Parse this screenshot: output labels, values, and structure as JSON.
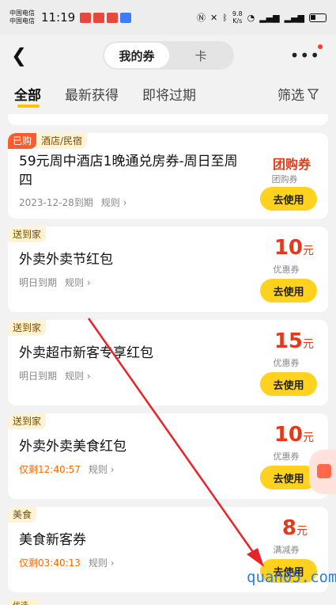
{
  "status_bar": {
    "carrier_1": "中国电信",
    "carrier_2": "中国电信",
    "time": "11:19",
    "net_speed_value": "9.8",
    "net_speed_unit": "K/s"
  },
  "nav": {
    "segment_active": "我的券",
    "segment_inactive": "卡"
  },
  "tabs": [
    {
      "label": "全部"
    },
    {
      "label": "最新获得"
    },
    {
      "label": "即将过期"
    }
  ],
  "filter_label": "筛选",
  "coupons": [
    {
      "bought_tag": "已购",
      "category": "酒店/民宿",
      "title_line1": "59元周中酒店1晚通兑房券-周日至周",
      "title_line2": "四",
      "expiry": "2023-12-28到期",
      "rule": "规则",
      "value_text": "团购券",
      "kind": "团购券",
      "button": "去使用"
    },
    {
      "category": "送到家",
      "title": "外卖外卖节红包",
      "expiry": "明日到期",
      "rule": "规则",
      "amount": "10",
      "unit": "元",
      "kind": "优惠券",
      "button": "去使用"
    },
    {
      "category": "送到家",
      "title": "外卖超市新客专享红包",
      "expiry": "明日到期",
      "rule": "规则",
      "amount": "15",
      "unit": "元",
      "kind": "优惠券",
      "button": "去使用"
    },
    {
      "category": "送到家",
      "title": "外卖外卖美食红包",
      "expiry": "仅剩12:40:57",
      "rule": "规则",
      "amount": "10",
      "unit": "元",
      "kind": "优惠券",
      "button": "去使用"
    },
    {
      "category": "美食",
      "title": "美食新客券",
      "expiry": "仅剩03:40:13",
      "rule": "规则",
      "amount": "8",
      "unit": "元",
      "kind": "满减券",
      "button": "去使用"
    }
  ],
  "next_card_tag": "优选",
  "watermark": "quan05.com",
  "colors": {
    "accent_yellow": "#ffd21f",
    "price_red": "#e23a1a",
    "arrow_red": "#e8232a"
  }
}
